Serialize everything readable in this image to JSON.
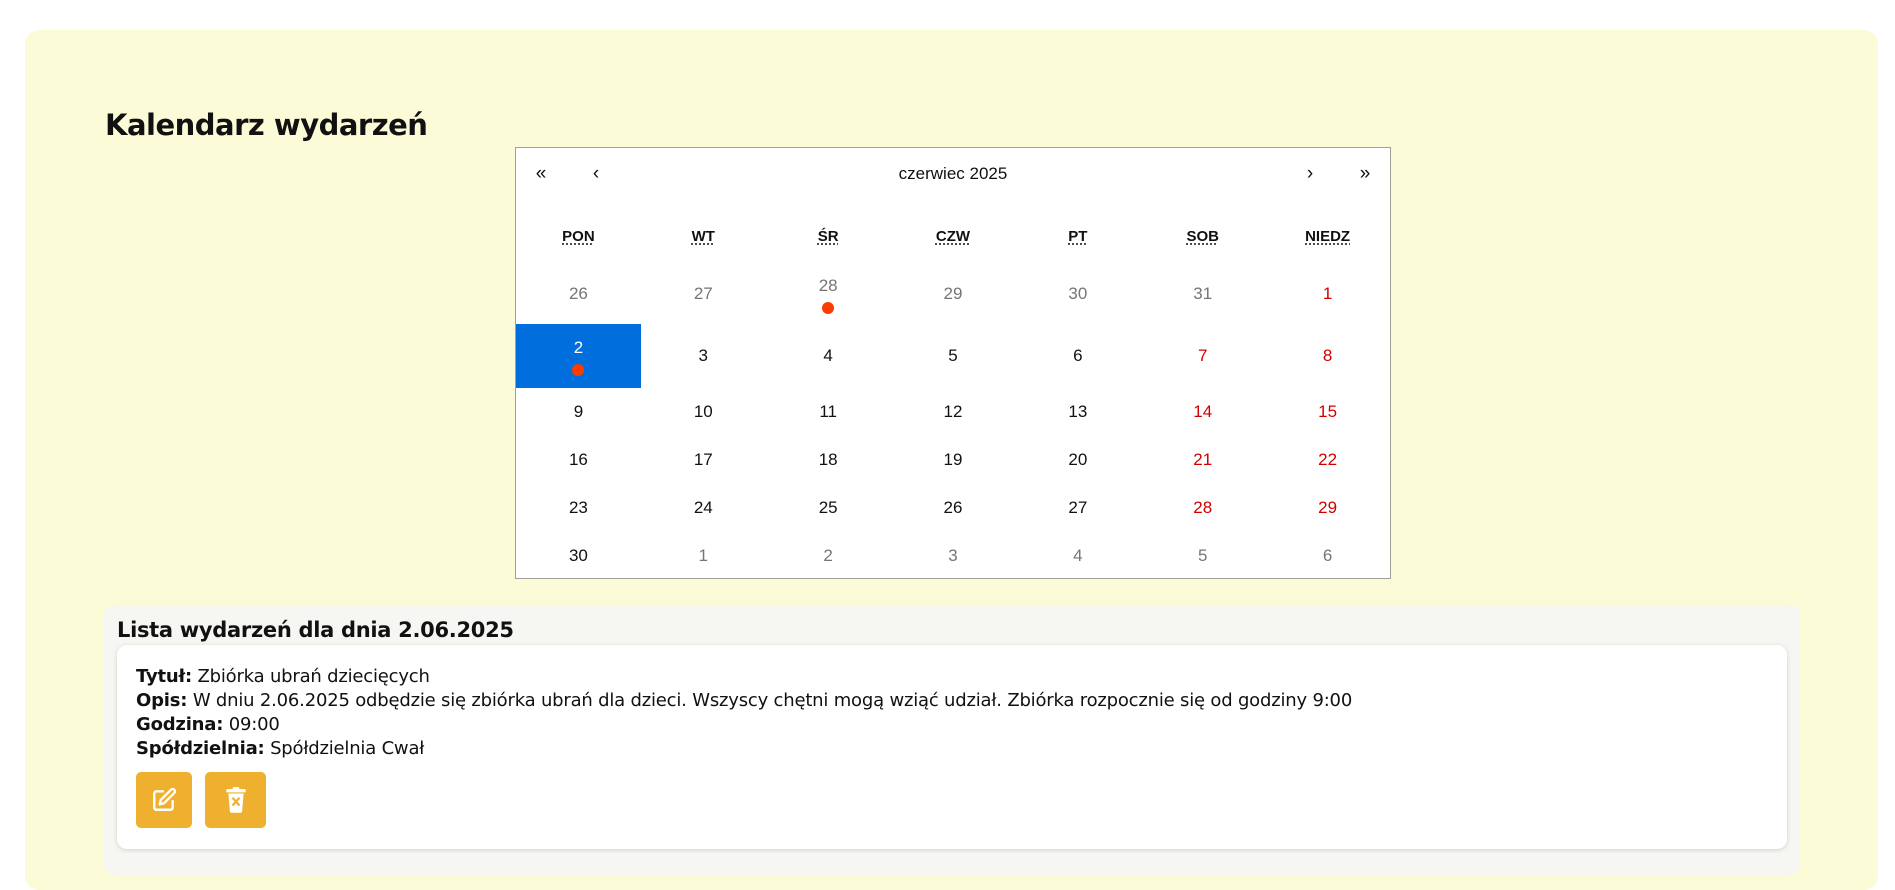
{
  "page": {
    "title": "Kalendarz wydarzeń"
  },
  "calendar": {
    "prev_year_label": "«",
    "prev_month_label": "‹",
    "month_label": "czerwiec 2025",
    "next_month_label": "›",
    "next_year_label": "»",
    "weekdays": [
      "PON",
      "WT",
      "ŚR",
      "CZW",
      "PT",
      "SOB",
      "NIEDZ"
    ],
    "weeks": [
      [
        "26",
        "27",
        "28",
        "29",
        "30",
        "31",
        "1"
      ],
      [
        "2",
        "3",
        "4",
        "5",
        "6",
        "7",
        "8"
      ],
      [
        "9",
        "10",
        "11",
        "12",
        "13",
        "14",
        "15"
      ],
      [
        "16",
        "17",
        "18",
        "19",
        "20",
        "21",
        "22"
      ],
      [
        "23",
        "24",
        "25",
        "26",
        "27",
        "28",
        "29"
      ],
      [
        "30",
        "1",
        "2",
        "3",
        "4",
        "5",
        "6"
      ]
    ],
    "selected_day": "2",
    "event_days": [
      "28 (maj)",
      "2"
    ],
    "colors": {
      "selected_bg": "#006edc",
      "weekend_text": "#d10000",
      "muted_text": "#757575",
      "event_dot": "#ff3c00"
    }
  },
  "events": {
    "heading": "Lista wydarzeń dla dnia 2.06.2025",
    "items": [
      {
        "title_label": "Tytuł:",
        "title": "Zbiórka ubrań dziecięcych",
        "desc_label": "Opis:",
        "desc": "W dniu 2.06.2025 odbędzie się zbiórka ubrań dla dzieci. Wszyscy chętni mogą wziąć udział. Zbiórka rozpocznie się od godziny 9:00",
        "time_label": "Godzina:",
        "time": "09:00",
        "coop_label": "Spółdzielnia:",
        "coop": "Spółdzielnia Cwał",
        "edit_icon": "edit-icon",
        "delete_icon": "delete-icon"
      }
    ],
    "button_color": "#eeb02e"
  }
}
